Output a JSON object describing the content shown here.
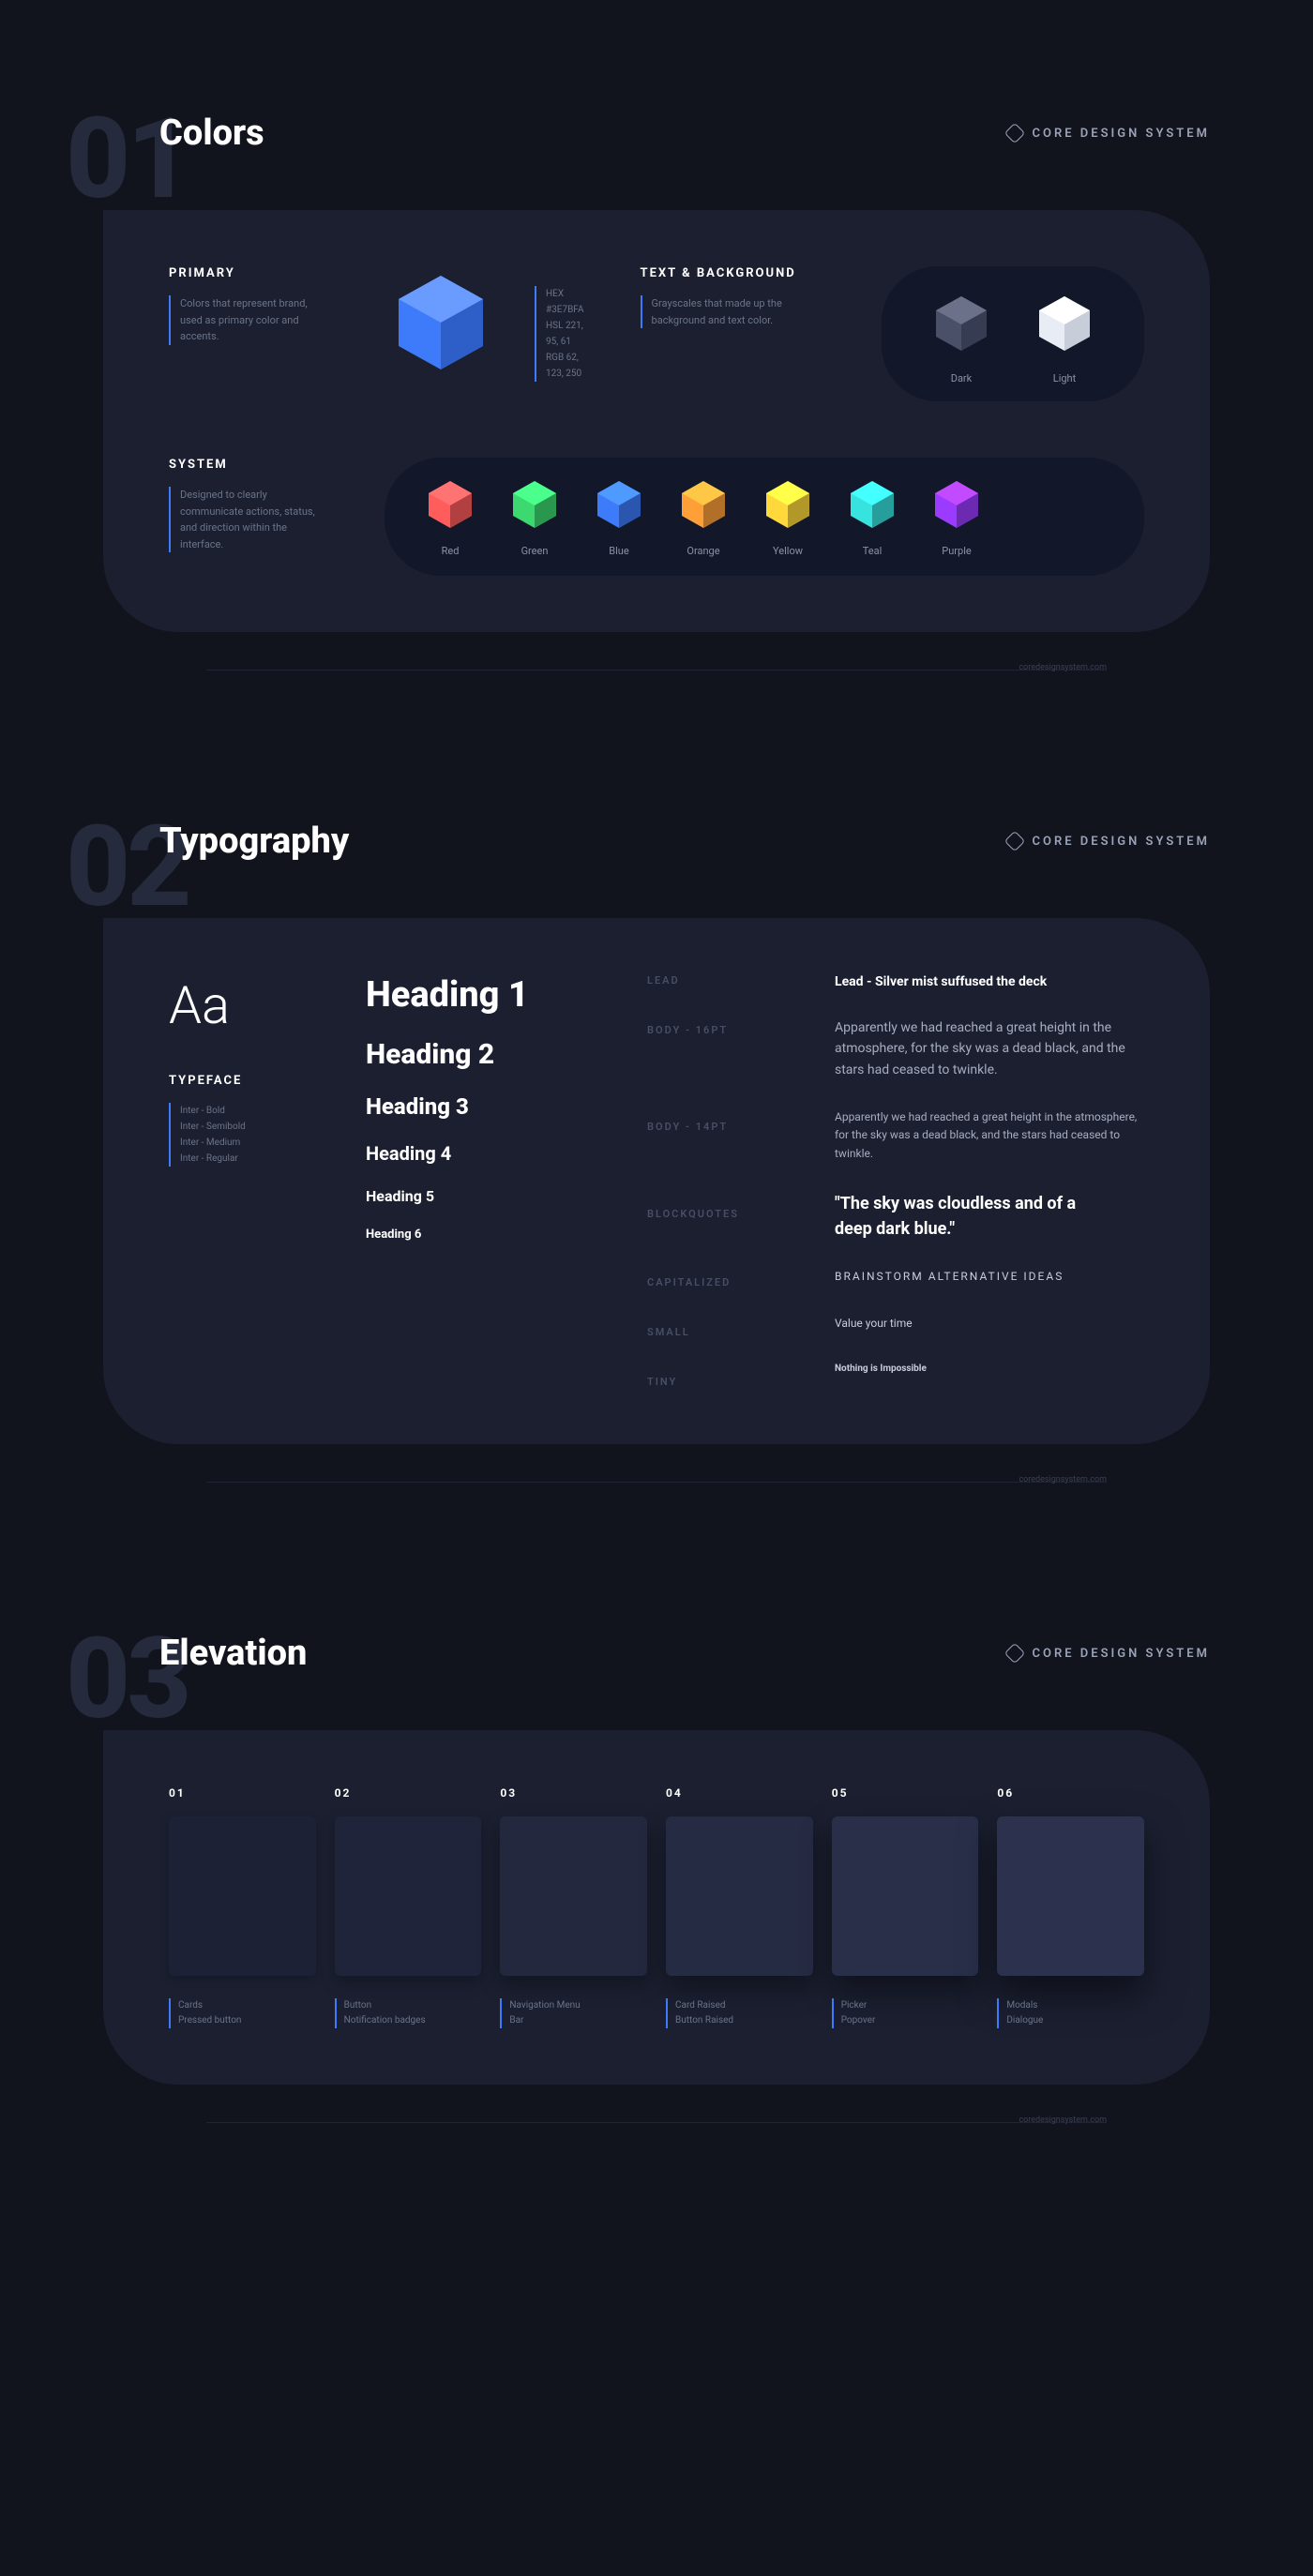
{
  "badge": "CORE DESIGN SYSTEM",
  "footer_url": "coredesignsystem.com",
  "sections": {
    "s1": {
      "number": "01",
      "title": "Colors"
    },
    "s2": {
      "number": "02",
      "title": "Typography"
    },
    "s3": {
      "number": "03",
      "title": "Elevation"
    }
  },
  "colors": {
    "primary": {
      "label": "PRIMARY",
      "desc": "Colors that represent brand, used as primary color and accents.",
      "hex": "HEX #3E7BFA",
      "hsl": "HSL 221, 95, 61",
      "rgb": "RGB 62, 123, 250"
    },
    "textbg": {
      "label": "TEXT & BACKGROUND",
      "desc": "Grayscales that made up the background and text color.",
      "dark_label": "Dark",
      "light_label": "Light"
    },
    "system": {
      "label": "SYSTEM",
      "desc": "Designed to clearly communicate actions, status, and direction within the interface.",
      "items": [
        {
          "name": "Red",
          "color": "#ff5c5c"
        },
        {
          "name": "Green",
          "color": "#3bd96f"
        },
        {
          "name": "Blue",
          "color": "#3e7bfa"
        },
        {
          "name": "Orange",
          "color": "#ff9f38"
        },
        {
          "name": "Yellow",
          "color": "#ffd93b"
        },
        {
          "name": "Teal",
          "color": "#36e3df"
        },
        {
          "name": "Purple",
          "color": "#9b3bff"
        }
      ]
    }
  },
  "typography": {
    "typeface_label": "TYPEFACE",
    "aa": "Aa",
    "weights": [
      "Inter - Bold",
      "Inter - Semibold",
      "Inter - Medium",
      "Inter - Regular"
    ],
    "headings": [
      "Heading 1",
      "Heading 2",
      "Heading 3",
      "Heading 4",
      "Heading 5",
      "Heading 6"
    ],
    "labels": {
      "lead": "LEAD",
      "body16": "BODY - 16PT",
      "body14": "BODY - 14PT",
      "blockquotes": "BLOCKQUOTES",
      "capitalized": "CAPITALIZED",
      "small": "SMALL",
      "tiny": "TINY"
    },
    "samples": {
      "lead": "Lead - Silver mist suffused the deck",
      "body16": "Apparently we had reached a great height in the atmosphere, for the sky was a dead black, and the stars had ceased to twinkle.",
      "body14": "Apparently we had reached a great height in the atmosphere, for the sky was a dead black, and the stars had ceased to twinkle.",
      "blockquotes": "\"The sky was cloudless and of a deep dark blue.\"",
      "capitalized": "BRAINSTORM ALTERNATIVE IDEAS",
      "small": "Value your time",
      "tiny": "Nothing is Impossible"
    }
  },
  "elevation": {
    "items": [
      {
        "num": "01",
        "desc": "Cards\nPressed button",
        "bg": "#1d2135"
      },
      {
        "num": "02",
        "desc": "Button\nNotification badges",
        "bg": "#20243a"
      },
      {
        "num": "03",
        "desc": "Navigation Menu\nBar",
        "bg": "#23283f"
      },
      {
        "num": "04",
        "desc": "Card Raised\nButton Raised",
        "bg": "#262b44"
      },
      {
        "num": "05",
        "desc": "Picker\nPopover",
        "bg": "#292f49"
      },
      {
        "num": "06",
        "desc": "Modals\nDialogue",
        "bg": "#2c324e"
      }
    ]
  }
}
